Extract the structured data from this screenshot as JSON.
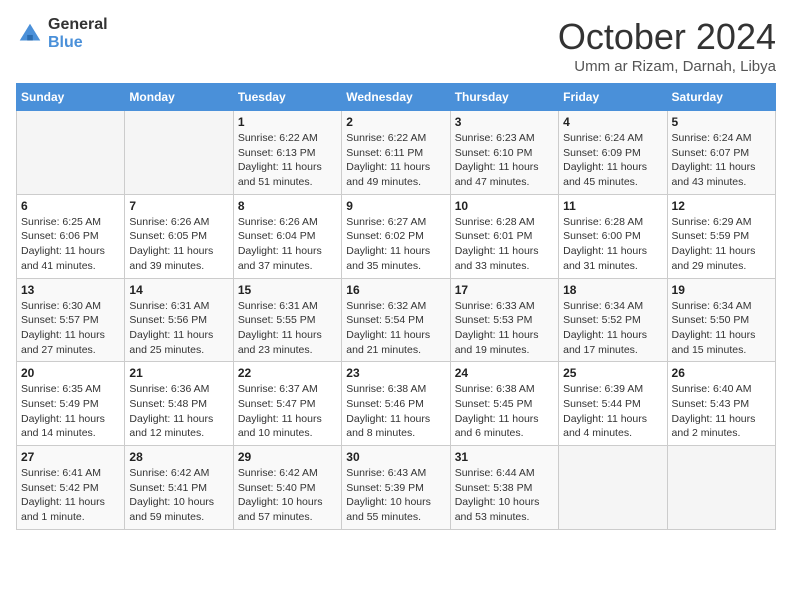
{
  "logo": {
    "general": "General",
    "blue": "Blue"
  },
  "title": "October 2024",
  "location": "Umm ar Rizam, Darnah, Libya",
  "weekdays": [
    "Sunday",
    "Monday",
    "Tuesday",
    "Wednesday",
    "Thursday",
    "Friday",
    "Saturday"
  ],
  "weeks": [
    [
      {
        "day": "",
        "info": ""
      },
      {
        "day": "",
        "info": ""
      },
      {
        "day": "1",
        "info": "Sunrise: 6:22 AM\nSunset: 6:13 PM\nDaylight: 11 hours and 51 minutes."
      },
      {
        "day": "2",
        "info": "Sunrise: 6:22 AM\nSunset: 6:11 PM\nDaylight: 11 hours and 49 minutes."
      },
      {
        "day": "3",
        "info": "Sunrise: 6:23 AM\nSunset: 6:10 PM\nDaylight: 11 hours and 47 minutes."
      },
      {
        "day": "4",
        "info": "Sunrise: 6:24 AM\nSunset: 6:09 PM\nDaylight: 11 hours and 45 minutes."
      },
      {
        "day": "5",
        "info": "Sunrise: 6:24 AM\nSunset: 6:07 PM\nDaylight: 11 hours and 43 minutes."
      }
    ],
    [
      {
        "day": "6",
        "info": "Sunrise: 6:25 AM\nSunset: 6:06 PM\nDaylight: 11 hours and 41 minutes."
      },
      {
        "day": "7",
        "info": "Sunrise: 6:26 AM\nSunset: 6:05 PM\nDaylight: 11 hours and 39 minutes."
      },
      {
        "day": "8",
        "info": "Sunrise: 6:26 AM\nSunset: 6:04 PM\nDaylight: 11 hours and 37 minutes."
      },
      {
        "day": "9",
        "info": "Sunrise: 6:27 AM\nSunset: 6:02 PM\nDaylight: 11 hours and 35 minutes."
      },
      {
        "day": "10",
        "info": "Sunrise: 6:28 AM\nSunset: 6:01 PM\nDaylight: 11 hours and 33 minutes."
      },
      {
        "day": "11",
        "info": "Sunrise: 6:28 AM\nSunset: 6:00 PM\nDaylight: 11 hours and 31 minutes."
      },
      {
        "day": "12",
        "info": "Sunrise: 6:29 AM\nSunset: 5:59 PM\nDaylight: 11 hours and 29 minutes."
      }
    ],
    [
      {
        "day": "13",
        "info": "Sunrise: 6:30 AM\nSunset: 5:57 PM\nDaylight: 11 hours and 27 minutes."
      },
      {
        "day": "14",
        "info": "Sunrise: 6:31 AM\nSunset: 5:56 PM\nDaylight: 11 hours and 25 minutes."
      },
      {
        "day": "15",
        "info": "Sunrise: 6:31 AM\nSunset: 5:55 PM\nDaylight: 11 hours and 23 minutes."
      },
      {
        "day": "16",
        "info": "Sunrise: 6:32 AM\nSunset: 5:54 PM\nDaylight: 11 hours and 21 minutes."
      },
      {
        "day": "17",
        "info": "Sunrise: 6:33 AM\nSunset: 5:53 PM\nDaylight: 11 hours and 19 minutes."
      },
      {
        "day": "18",
        "info": "Sunrise: 6:34 AM\nSunset: 5:52 PM\nDaylight: 11 hours and 17 minutes."
      },
      {
        "day": "19",
        "info": "Sunrise: 6:34 AM\nSunset: 5:50 PM\nDaylight: 11 hours and 15 minutes."
      }
    ],
    [
      {
        "day": "20",
        "info": "Sunrise: 6:35 AM\nSunset: 5:49 PM\nDaylight: 11 hours and 14 minutes."
      },
      {
        "day": "21",
        "info": "Sunrise: 6:36 AM\nSunset: 5:48 PM\nDaylight: 11 hours and 12 minutes."
      },
      {
        "day": "22",
        "info": "Sunrise: 6:37 AM\nSunset: 5:47 PM\nDaylight: 11 hours and 10 minutes."
      },
      {
        "day": "23",
        "info": "Sunrise: 6:38 AM\nSunset: 5:46 PM\nDaylight: 11 hours and 8 minutes."
      },
      {
        "day": "24",
        "info": "Sunrise: 6:38 AM\nSunset: 5:45 PM\nDaylight: 11 hours and 6 minutes."
      },
      {
        "day": "25",
        "info": "Sunrise: 6:39 AM\nSunset: 5:44 PM\nDaylight: 11 hours and 4 minutes."
      },
      {
        "day": "26",
        "info": "Sunrise: 6:40 AM\nSunset: 5:43 PM\nDaylight: 11 hours and 2 minutes."
      }
    ],
    [
      {
        "day": "27",
        "info": "Sunrise: 6:41 AM\nSunset: 5:42 PM\nDaylight: 11 hours and 1 minute."
      },
      {
        "day": "28",
        "info": "Sunrise: 6:42 AM\nSunset: 5:41 PM\nDaylight: 10 hours and 59 minutes."
      },
      {
        "day": "29",
        "info": "Sunrise: 6:42 AM\nSunset: 5:40 PM\nDaylight: 10 hours and 57 minutes."
      },
      {
        "day": "30",
        "info": "Sunrise: 6:43 AM\nSunset: 5:39 PM\nDaylight: 10 hours and 55 minutes."
      },
      {
        "day": "31",
        "info": "Sunrise: 6:44 AM\nSunset: 5:38 PM\nDaylight: 10 hours and 53 minutes."
      },
      {
        "day": "",
        "info": ""
      },
      {
        "day": "",
        "info": ""
      }
    ]
  ]
}
